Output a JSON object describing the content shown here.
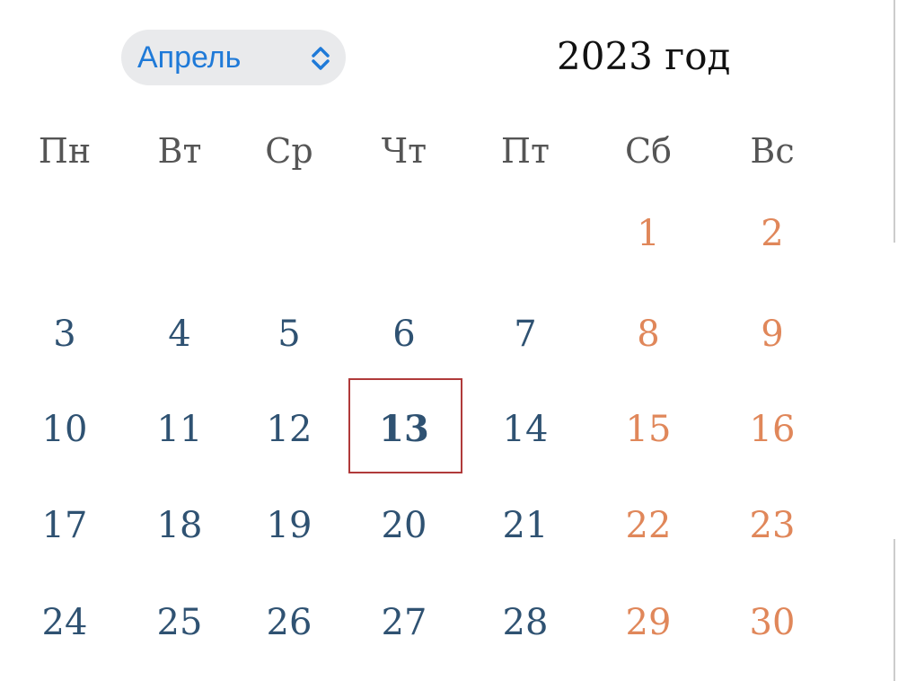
{
  "month_selector": {
    "label": "Апрель",
    "icon": "chevron-up-down-icon",
    "color": "#1f7ad8"
  },
  "year_title": "2023 год",
  "weekdays": [
    "Пн",
    "Вт",
    "Ср",
    "Чт",
    "Пт",
    "Сб",
    "Вс"
  ],
  "first_weekday_index": 5,
  "days_in_month": 30,
  "today": 13,
  "colors": {
    "weekday": "#2f5272",
    "weekend": "#e0875a",
    "header": "#555555",
    "today_border": "#b03a3a"
  }
}
